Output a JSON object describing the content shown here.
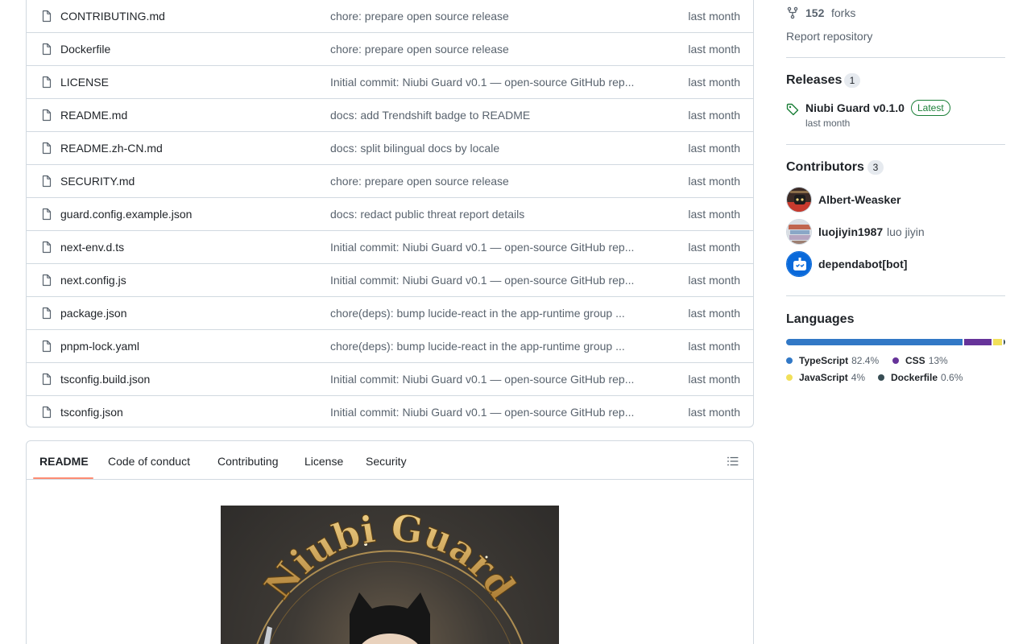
{
  "files": [
    {
      "name": "CONTRIBUTING.md",
      "commit": "chore: prepare open source release",
      "date": "last month"
    },
    {
      "name": "Dockerfile",
      "commit": "chore: prepare open source release",
      "date": "last month"
    },
    {
      "name": "LICENSE",
      "commit": "Initial commit: Niubi Guard v0.1 — open-source GitHub rep...",
      "date": "last month"
    },
    {
      "name": "README.md",
      "commit": "docs: add Trendshift badge to README",
      "date": "last month"
    },
    {
      "name": "README.zh-CN.md",
      "commit": "docs: split bilingual docs by locale",
      "date": "last month"
    },
    {
      "name": "SECURITY.md",
      "commit": "chore: prepare open source release",
      "date": "last month"
    },
    {
      "name": "guard.config.example.json",
      "commit": "docs: redact public threat report details",
      "date": "last month"
    },
    {
      "name": "next-env.d.ts",
      "commit": "Initial commit: Niubi Guard v0.1 — open-source GitHub rep...",
      "date": "last month"
    },
    {
      "name": "next.config.js",
      "commit": "Initial commit: Niubi Guard v0.1 — open-source GitHub rep...",
      "date": "last month"
    },
    {
      "name": "package.json",
      "commit": "chore(deps): bump lucide-react in the app-runtime group ...",
      "date": "last month"
    },
    {
      "name": "pnpm-lock.yaml",
      "commit": "chore(deps): bump lucide-react in the app-runtime group ...",
      "date": "last month"
    },
    {
      "name": "tsconfig.build.json",
      "commit": "Initial commit: Niubi Guard v0.1 — open-source GitHub rep...",
      "date": "last month"
    },
    {
      "name": "tsconfig.json",
      "commit": "Initial commit: Niubi Guard v0.1 — open-source GitHub rep...",
      "date": "last month"
    }
  ],
  "readme": {
    "tabs": [
      "README",
      "Code of conduct",
      "Contributing",
      "License",
      "Security"
    ],
    "active_tab": "README",
    "banner_text": "Niubi Guard"
  },
  "sidebar": {
    "forks_count": "152",
    "forks_label": "forks",
    "report_label": "Report repository",
    "releases": {
      "title": "Releases",
      "count": "1",
      "latest_name": "Niubi Guard v0.1.0",
      "latest_badge": "Latest",
      "latest_date": "last month"
    },
    "contributors": {
      "title": "Contributors",
      "count": "3",
      "list": [
        {
          "login": "Albert-Weasker",
          "name": ""
        },
        {
          "login": "luojiyin1987",
          "name": "luo jiyin"
        },
        {
          "login": "dependabot[bot]",
          "name": ""
        }
      ]
    },
    "languages": {
      "title": "Languages",
      "list": [
        {
          "name": "TypeScript",
          "percent": "82.4%",
          "value": 82.4,
          "color": "#3178c6"
        },
        {
          "name": "CSS",
          "percent": "13%",
          "value": 13,
          "color": "#663399"
        },
        {
          "name": "JavaScript",
          "percent": "4%",
          "value": 4,
          "color": "#f1e05a"
        },
        {
          "name": "Dockerfile",
          "percent": "0.6%",
          "value": 0.6,
          "color": "#384d54"
        }
      ]
    }
  }
}
